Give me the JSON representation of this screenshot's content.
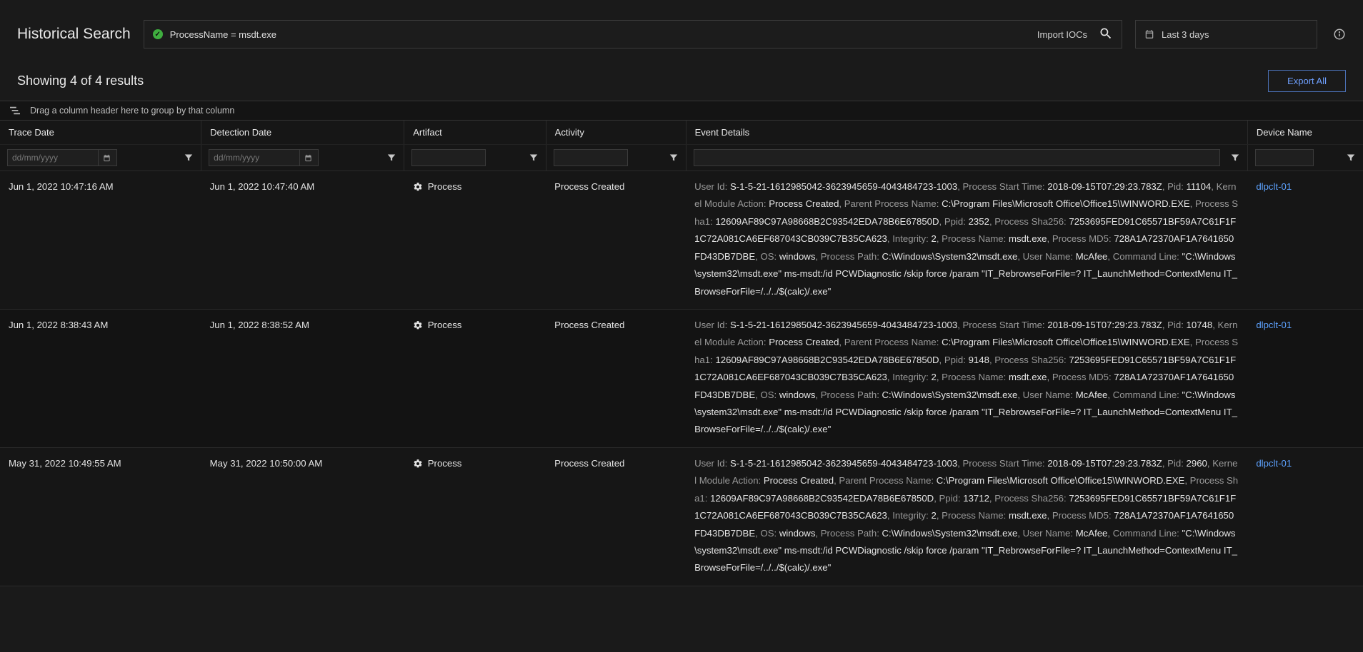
{
  "header": {
    "title": "Historical Search",
    "query": "ProcessName = msdt.exe",
    "import_iocs": "Import IOCs",
    "time_range": "Last 3 days"
  },
  "results": {
    "summary": "Showing 4 of 4 results",
    "export_label": "Export All"
  },
  "group_hint": "Drag a column header here to group by that column",
  "columns": {
    "trace_date": "Trace Date",
    "detection_date": "Detection Date",
    "artifact": "Artifact",
    "activity": "Activity",
    "event_details": "Event Details",
    "device_name": "Device Name"
  },
  "filters": {
    "date_placeholder": "dd/mm/yyyy"
  },
  "rows": [
    {
      "trace_date": "Jun 1, 2022 10:47:16 AM",
      "detection_date": "Jun 1, 2022 10:47:40 AM",
      "artifact": "Process",
      "activity": "Process Created",
      "device": "dlpclt-01",
      "details": [
        {
          "k": "User Id",
          "v": "S-1-5-21-1612985042-3623945659-4043484723-1003"
        },
        {
          "k": "Process Start Time",
          "v": "2018-09-15T07:29:23.783Z"
        },
        {
          "k": "Pid",
          "v": "11104"
        },
        {
          "k": "Kernel Module Action",
          "v": "Process Created"
        },
        {
          "k": "Parent Process Name",
          "v": "C:\\Program Files\\Microsoft Office\\Office15\\WINWORD.EXE"
        },
        {
          "k": "Process Sha1",
          "v": "12609AF89C97A98668B2C93542EDA78B6E67850D"
        },
        {
          "k": "Ppid",
          "v": "2352"
        },
        {
          "k": "Process Sha256",
          "v": "7253695FED91C65571BF59A7C61F1F1C72A081CA6EF687043CB039C7B35CA623"
        },
        {
          "k": "Integrity",
          "v": "2"
        },
        {
          "k": "Process Name",
          "v": "msdt.exe"
        },
        {
          "k": "Process MD5",
          "v": "728A1A72370AF1A7641650FD43DB7DBE"
        },
        {
          "k": "OS",
          "v": "windows"
        },
        {
          "k": "Process Path",
          "v": "C:\\Windows\\System32\\msdt.exe"
        },
        {
          "k": "User Name",
          "v": "McAfee"
        },
        {
          "k": "Command Line",
          "v": "\"C:\\Windows\\system32\\msdt.exe\" ms-msdt:/id PCWDiagnostic /skip force /param \"IT_RebrowseForFile=? IT_LaunchMethod=ContextMenu IT_BrowseForFile=/../../$(calc)/.exe\""
        }
      ]
    },
    {
      "trace_date": "Jun 1, 2022 8:38:43 AM",
      "detection_date": "Jun 1, 2022 8:38:52 AM",
      "artifact": "Process",
      "activity": "Process Created",
      "device": "dlpclt-01",
      "details": [
        {
          "k": "User Id",
          "v": "S-1-5-21-1612985042-3623945659-4043484723-1003"
        },
        {
          "k": "Process Start Time",
          "v": "2018-09-15T07:29:23.783Z"
        },
        {
          "k": "Pid",
          "v": "10748"
        },
        {
          "k": "Kernel Module Action",
          "v": "Process Created"
        },
        {
          "k": "Parent Process Name",
          "v": "C:\\Program Files\\Microsoft Office\\Office15\\WINWORD.EXE"
        },
        {
          "k": "Process Sha1",
          "v": "12609AF89C97A98668B2C93542EDA78B6E67850D"
        },
        {
          "k": "Ppid",
          "v": "9148"
        },
        {
          "k": "Process Sha256",
          "v": "7253695FED91C65571BF59A7C61F1F1C72A081CA6EF687043CB039C7B35CA623"
        },
        {
          "k": "Integrity",
          "v": "2"
        },
        {
          "k": "Process Name",
          "v": "msdt.exe"
        },
        {
          "k": "Process MD5",
          "v": "728A1A72370AF1A7641650FD43DB7DBE"
        },
        {
          "k": "OS",
          "v": "windows"
        },
        {
          "k": "Process Path",
          "v": "C:\\Windows\\System32\\msdt.exe"
        },
        {
          "k": "User Name",
          "v": "McAfee"
        },
        {
          "k": "Command Line",
          "v": "\"C:\\Windows\\system32\\msdt.exe\" ms-msdt:/id PCWDiagnostic /skip force /param \"IT_RebrowseForFile=? IT_LaunchMethod=ContextMenu IT_BrowseForFile=/../../$(calc)/.exe\""
        }
      ]
    },
    {
      "trace_date": "May 31, 2022 10:49:55 AM",
      "detection_date": "May 31, 2022 10:50:00 AM",
      "artifact": "Process",
      "activity": "Process Created",
      "device": "dlpclt-01",
      "details": [
        {
          "k": "User Id",
          "v": "S-1-5-21-1612985042-3623945659-4043484723-1003"
        },
        {
          "k": "Process Start Time",
          "v": "2018-09-15T07:29:23.783Z"
        },
        {
          "k": "Pid",
          "v": "2960"
        },
        {
          "k": "Kernel Module Action",
          "v": "Process Created"
        },
        {
          "k": "Parent Process Name",
          "v": "C:\\Program Files\\Microsoft Office\\Office15\\WINWORD.EXE"
        },
        {
          "k": "Process Sha1",
          "v": "12609AF89C97A98668B2C93542EDA78B6E67850D"
        },
        {
          "k": "Ppid",
          "v": "13712"
        },
        {
          "k": "Process Sha256",
          "v": "7253695FED91C65571BF59A7C61F1F1C72A081CA6EF687043CB039C7B35CA623"
        },
        {
          "k": "Integrity",
          "v": "2"
        },
        {
          "k": "Process Name",
          "v": "msdt.exe"
        },
        {
          "k": "Process MD5",
          "v": "728A1A72370AF1A7641650FD43DB7DBE"
        },
        {
          "k": "OS",
          "v": "windows"
        },
        {
          "k": "Process Path",
          "v": "C:\\Windows\\System32\\msdt.exe"
        },
        {
          "k": "User Name",
          "v": "McAfee"
        },
        {
          "k": "Command Line",
          "v": "\"C:\\Windows\\system32\\msdt.exe\" ms-msdt:/id PCWDiagnostic /skip force /param \"IT_RebrowseForFile=? IT_LaunchMethod=ContextMenu IT_BrowseForFile=/../../$(calc)/.exe\""
        }
      ]
    }
  ]
}
